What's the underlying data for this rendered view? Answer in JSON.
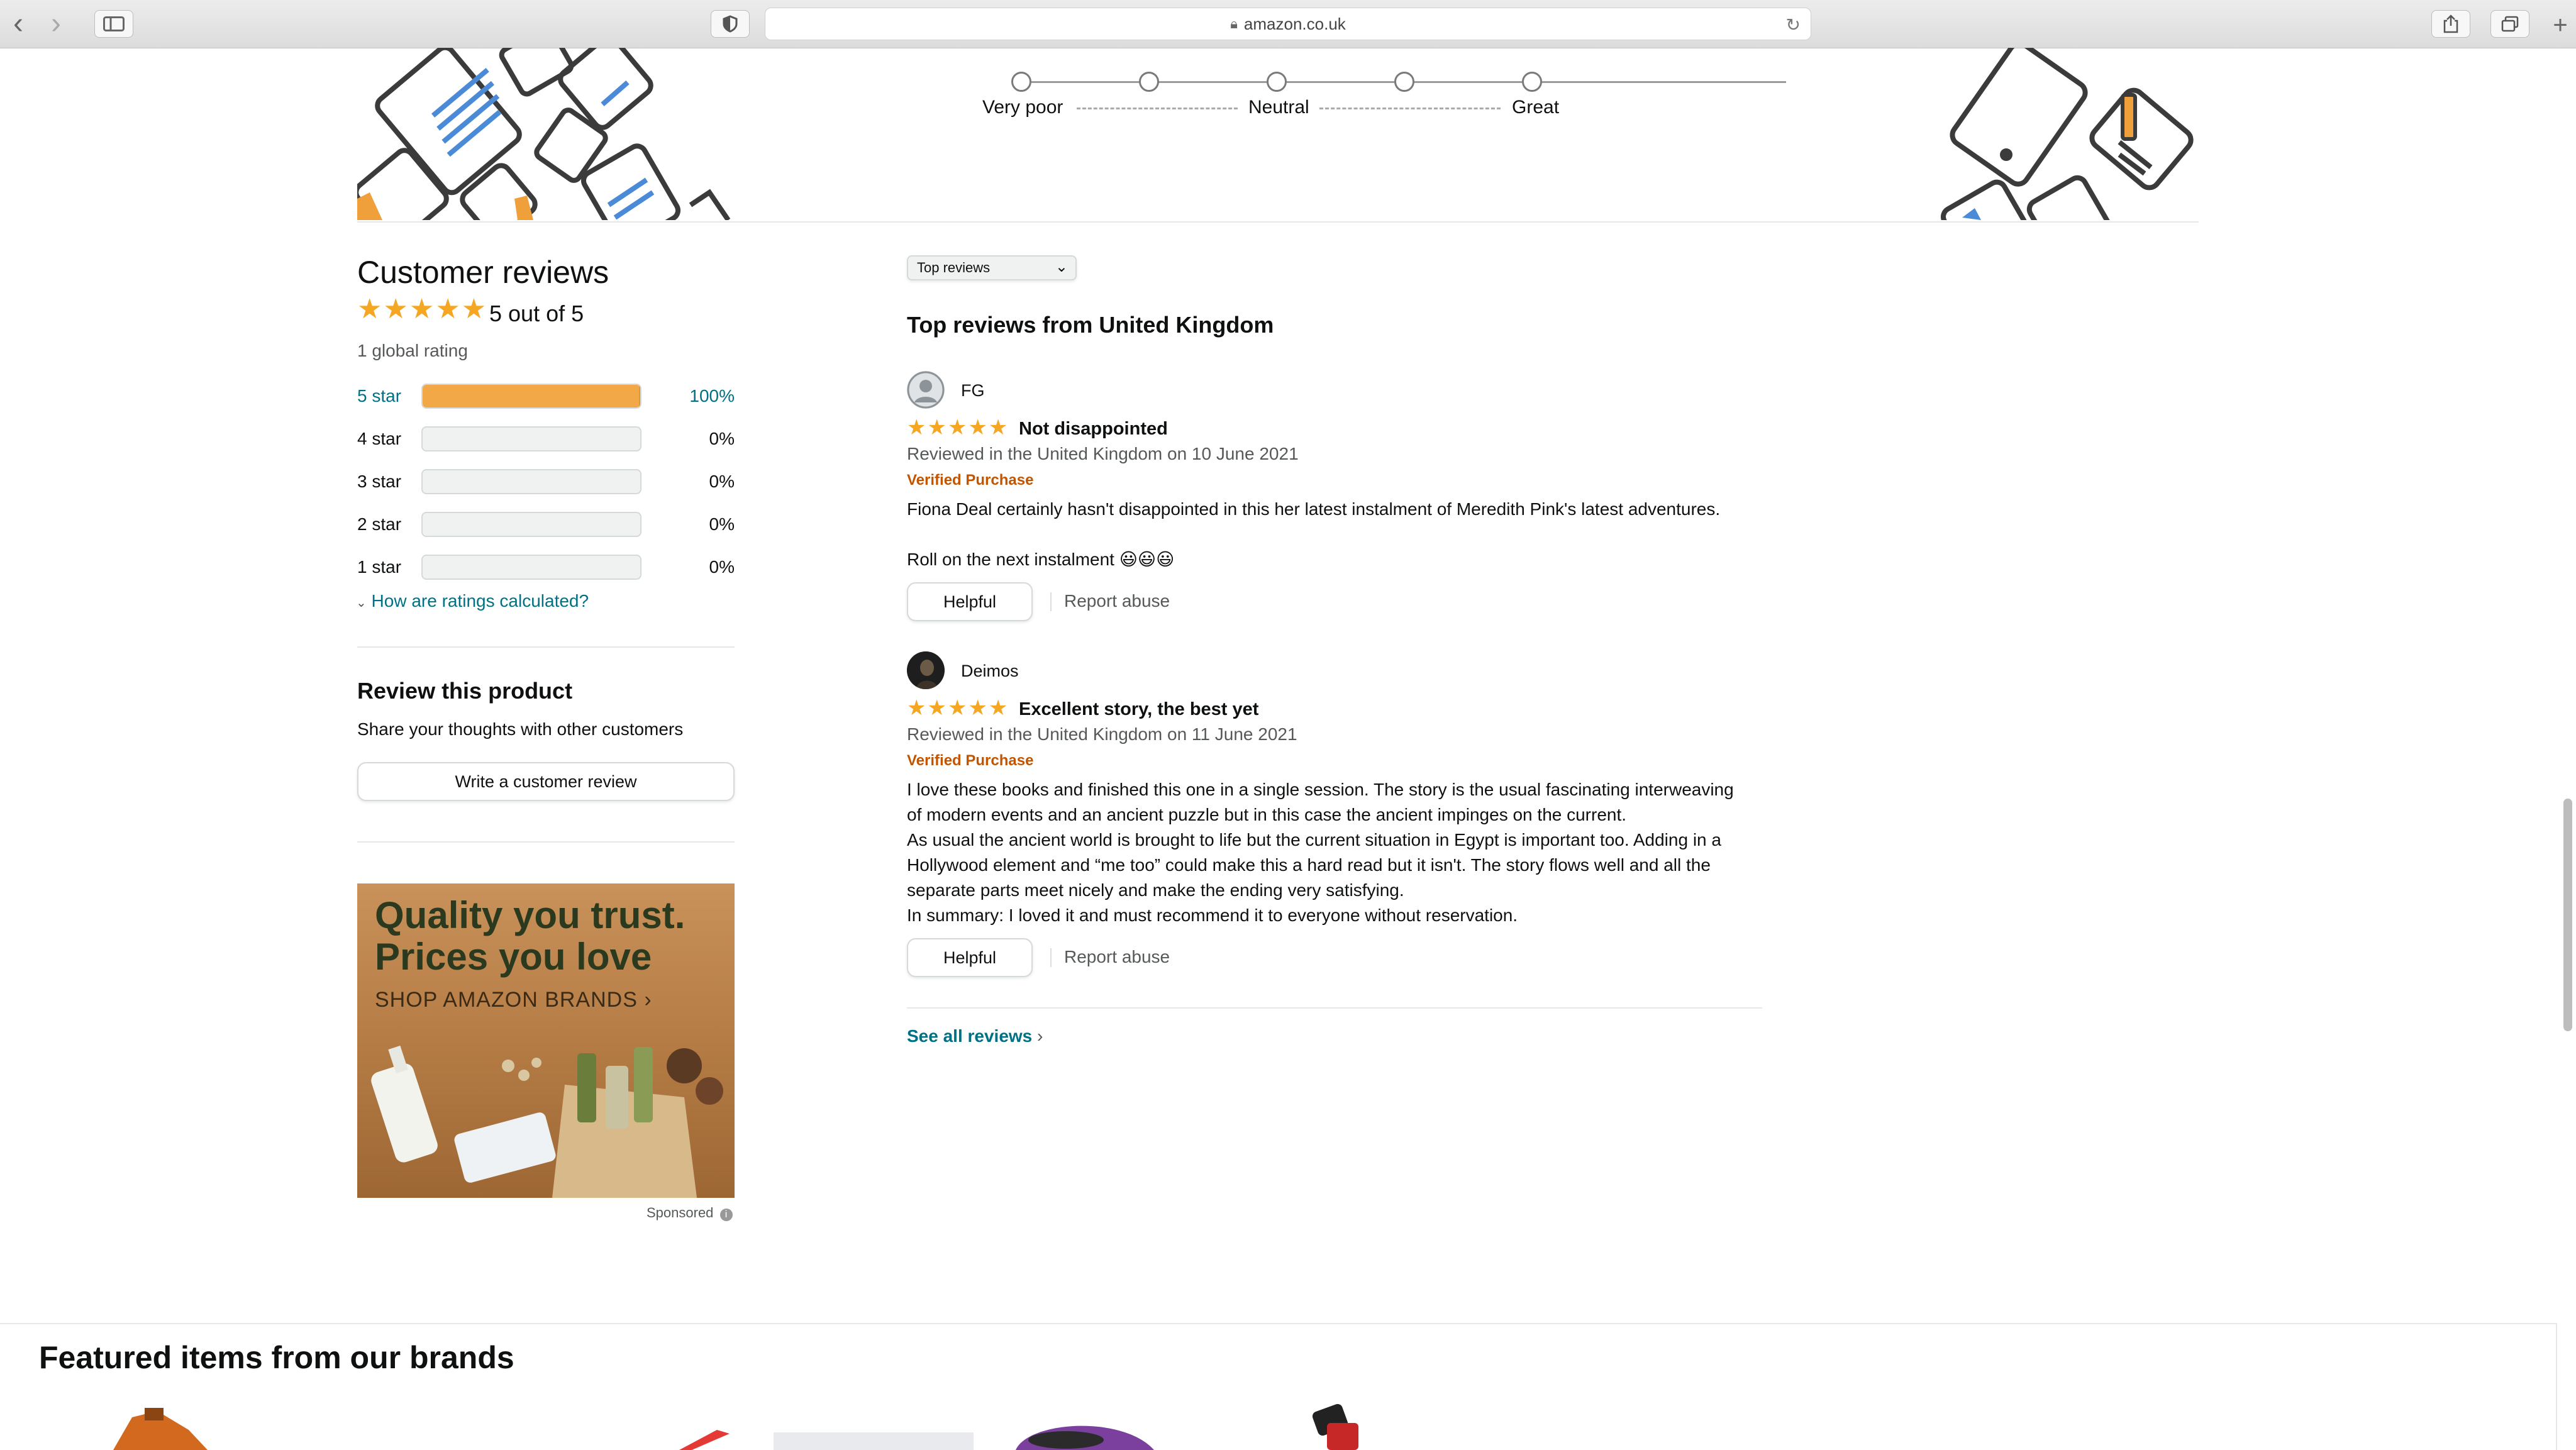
{
  "browser": {
    "url": "amazon.co.uk",
    "back_icon": "‹",
    "forward_icon": "›",
    "plus_icon": "+"
  },
  "rating_scale": {
    "labels": [
      "Very poor",
      "Neutral",
      "Great"
    ]
  },
  "summary": {
    "heading": "Customer reviews",
    "stars": "★★★★★",
    "rating_text": "5 out of 5",
    "global_ratings": "1 global rating",
    "histogram": [
      {
        "label": "5 star",
        "pct": "100%",
        "fill": 1.0
      },
      {
        "label": "4 star",
        "pct": "0%",
        "fill": 0
      },
      {
        "label": "3 star",
        "pct": "0%",
        "fill": 0
      },
      {
        "label": "2 star",
        "pct": "0%",
        "fill": 0
      },
      {
        "label": "1 star",
        "pct": "0%",
        "fill": 0
      }
    ],
    "how_calculated": "How are ratings calculated?"
  },
  "review_product": {
    "heading": "Review this product",
    "subtext": "Share your thoughts with other customers",
    "button": "Write a customer review"
  },
  "ad": {
    "headline_1": "Quality you trust.",
    "headline_2": "Prices you love",
    "cta": "SHOP AMAZON BRANDS ›",
    "sponsored": "Sponsored"
  },
  "reviews_section": {
    "sort_selected": "Top reviews",
    "heading": "Top reviews from United Kingdom",
    "see_all": "See all reviews",
    "reviews": [
      {
        "author": "FG",
        "stars": "★★★★★",
        "title": "Not disappointed",
        "date": "Reviewed in the United Kingdom on 10 June 2021",
        "verified": "Verified Purchase",
        "body": [
          "Fiona Deal certainly hasn't disappointed in this her latest instalment of Meredith Pink's latest adventures.",
          "",
          "Roll on the next instalment 😃😃😃"
        ],
        "helpful": "Helpful",
        "report": "Report abuse"
      },
      {
        "author": "Deimos",
        "stars": "★★★★★",
        "title": "Excellent story, the best yet",
        "date": "Reviewed in the United Kingdom on 11 June 2021",
        "verified": "Verified Purchase",
        "body": [
          "I love these books and finished this one in a single session. The story is the usual fascinating interweaving",
          "of modern events and an ancient puzzle but in this case the ancient impinges on the current.",
          "As usual the ancient world is brought to life but the current situation in Egypt is important too. Adding in a",
          "Hollywood element and “me too” could make this a hard read but it isn't. The story flows well and all the",
          "separate parts meet nicely and make the ending very satisfying.",
          "In summary: I loved it and must recommend it to everyone without reservation."
        ],
        "helpful": "Helpful",
        "report": "Report abuse"
      }
    ]
  },
  "featured": {
    "heading": "Featured items from our brands"
  }
}
